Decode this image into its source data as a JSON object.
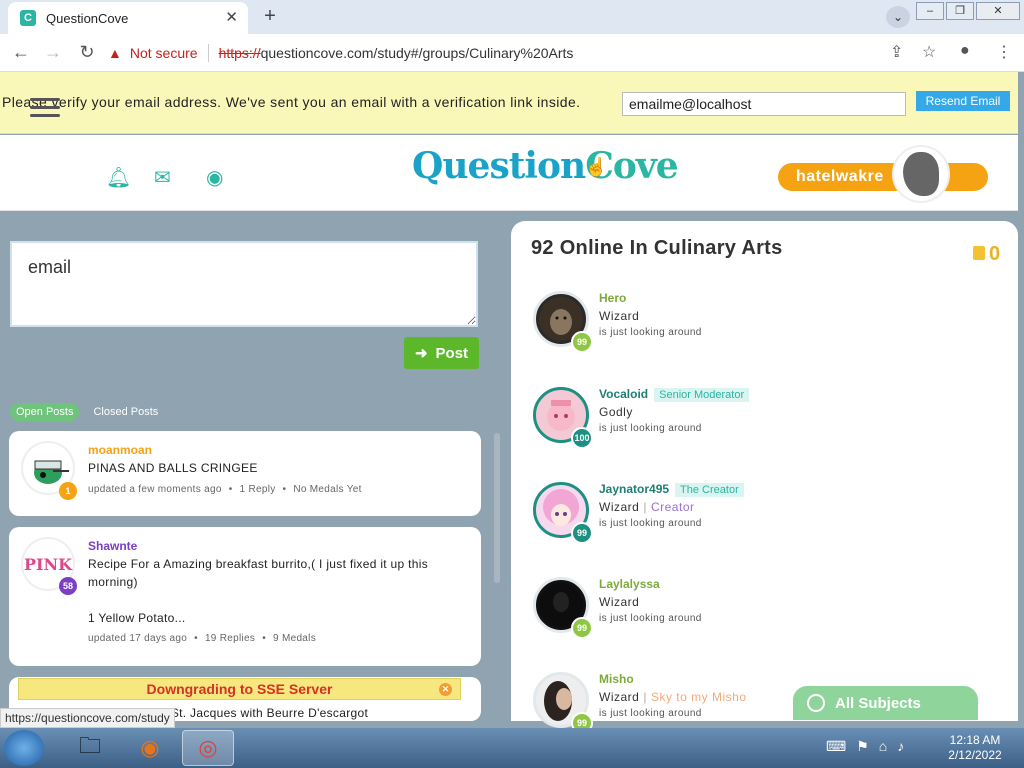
{
  "browser": {
    "tab_title": "QuestionCove",
    "tab_favicon_text": "C",
    "not_secure": "Not secure",
    "url_scheme": "https://",
    "url_rest": "questioncove.com/study#/groups/Culinary%20Arts",
    "status_url": "https://questioncove.com/study"
  },
  "verify": {
    "message": "Please verify your email address. We've sent you an email with a verification link inside.",
    "email_value": "emailme@localhost",
    "resend_label": "Resend Email"
  },
  "header": {
    "logo_part1": "Question",
    "logo_part2": "Cove",
    "username": "hatelwakre"
  },
  "composer": {
    "text": "email",
    "post_label": "Post"
  },
  "filters": {
    "open": "Open Posts",
    "closed": "Closed Posts"
  },
  "posts": [
    {
      "user": "moanmoan",
      "user_color": "#f5a313",
      "title": "PINAS AND BALLS CRINGEE",
      "body": "",
      "updated": "updated a few moments ago",
      "replies": "1 Reply",
      "medals": "No Medals Yet",
      "level": "1",
      "level_color": "#f5a313"
    },
    {
      "user": "Shawnte",
      "user_color": "#7b3fc4",
      "title": "Recipe For a Amazing breakfast burrito,( I just fixed it up this morning)",
      "body": "1 Yellow Potato...",
      "updated": "updated 17 days ago",
      "replies": "19 Replies",
      "medals": "9 Medals",
      "level": "58",
      "level_color": "#7b3fc4",
      "avatar_text": "PINK"
    }
  ],
  "sse_banner": "Downgrading to SSE Server",
  "card3_text": "lles St. Jacques with Beurre D'escargot",
  "online": {
    "title": "92 Online In Culinary Arts",
    "medals": "0",
    "users": [
      {
        "name": "Hero",
        "name_color": "#7cab3a",
        "tag": "",
        "rank": "Wizard",
        "extra": "",
        "status": "is just looking around",
        "level": "99",
        "level_color": "#8fc744"
      },
      {
        "name": "Vocaloid",
        "name_color": "#1e7f74",
        "tag": "Senior Moderator",
        "rank": "Godly",
        "extra": "",
        "status": "is just looking around",
        "level": "100",
        "level_color": "#1e8f83"
      },
      {
        "name": "Jaynator495",
        "name_color": "#1e7f74",
        "tag": "The Creator",
        "rank": "Wizard",
        "extra": "Creator",
        "status": "is just looking around",
        "level": "99",
        "level_color": "#1e8f83"
      },
      {
        "name": "Laylalyssa",
        "name_color": "#7cab3a",
        "tag": "",
        "rank": "Wizard",
        "extra": "",
        "status": "is just looking around",
        "level": "99",
        "level_color": "#8fc744"
      },
      {
        "name": "Misho",
        "name_color": "#7cab3a",
        "tag": "",
        "rank": "Wizard",
        "extra": "Sky to my Misho",
        "status": "is just looking around",
        "level": "99",
        "level_color": "#8fc744"
      }
    ],
    "all_subjects": "All Subjects"
  },
  "taskbar": {
    "time": "12:18 AM",
    "date": "2/12/2022"
  },
  "colors": {
    "accent_teal": "#2bb5a3",
    "accent_orange": "#f5a313",
    "post_green": "#5cb82a",
    "banner_yellow": "#faf8b9"
  }
}
